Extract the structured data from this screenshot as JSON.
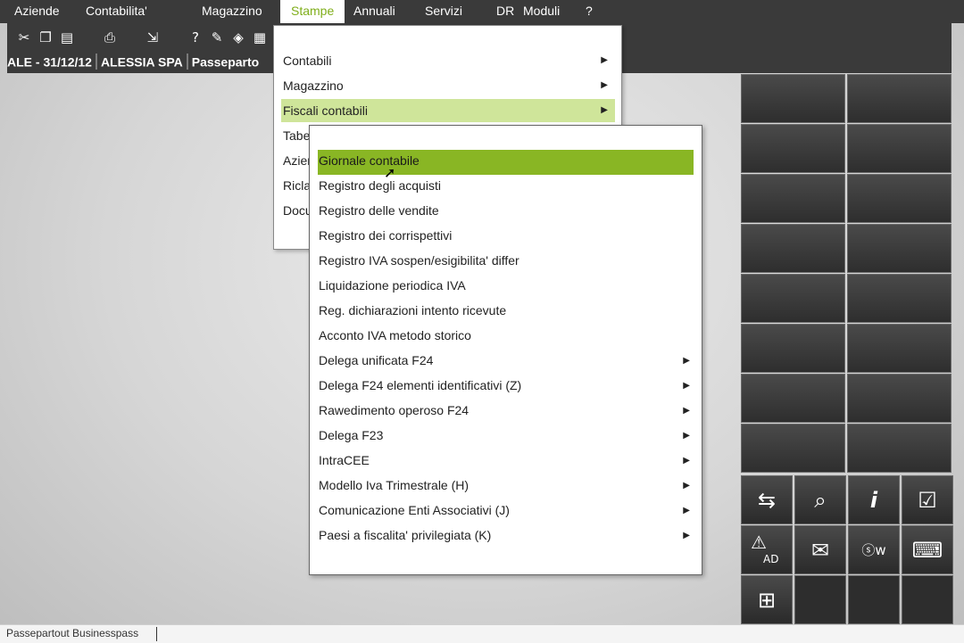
{
  "menubar": {
    "items": [
      "Aziende",
      "Contabilita'",
      "Magazzino",
      "Stampe",
      "Annuali",
      "Servizi",
      "DR",
      "Moduli",
      "?"
    ],
    "active": "Stampe"
  },
  "toolbar": {
    "icons": [
      "scissors-icon",
      "copy-icon",
      "paste-icon",
      "print-icon",
      "export-icon",
      "help-icon",
      "notes-icon",
      "box-icon",
      "calculator-icon"
    ]
  },
  "infobar": {
    "company_code_date": "ALE - 31/12/12",
    "company_name": "ALESSIA SPA",
    "app_name": "Passeparto"
  },
  "stampe_menu": {
    "items": [
      {
        "label": "Contabili",
        "has_submenu": true
      },
      {
        "label": "Magazzino",
        "has_submenu": true
      },
      {
        "label": "Fiscali contabili",
        "has_submenu": true,
        "highlighted": true
      },
      {
        "label": "Tabe",
        "has_submenu": false
      },
      {
        "label": "Azien",
        "has_submenu": false
      },
      {
        "label": "Ricla",
        "has_submenu": false
      },
      {
        "label": "Docu",
        "has_submenu": false
      }
    ]
  },
  "fiscali_submenu": {
    "items": [
      {
        "label": "Giornale contabile",
        "selected": true
      },
      {
        "label": "Registro degli acquisti"
      },
      {
        "label": "Registro delle vendite"
      },
      {
        "label": "Registro dei corrispettivi"
      },
      {
        "label": "Registro IVA sospen/esigibilita' differ"
      },
      {
        "label": "Liquidazione periodica IVA"
      },
      {
        "label": "Reg. dichiarazioni intento ricevute"
      },
      {
        "label": "Acconto IVA metodo storico"
      },
      {
        "label": "Delega unificata F24",
        "has_submenu": true
      },
      {
        "label": "Delega F24 elementi identificativi (Z)",
        "has_submenu": true
      },
      {
        "label": "Rawedimento operoso F24",
        "has_submenu": true
      },
      {
        "label": "Delega F23",
        "has_submenu": true
      },
      {
        "label": "IntraCEE",
        "has_submenu": true
      },
      {
        "label": "Modello Iva Trimestrale (H)",
        "has_submenu": true
      },
      {
        "label": "Comunicazione Enti Associativi (J)",
        "has_submenu": true
      },
      {
        "label": "Paesi a fiscalita' privilegiata (K)",
        "has_submenu": true
      }
    ]
  },
  "quick_icons": {
    "row1": [
      "transfer-icon",
      "document-search-icon",
      "info-icon",
      "checklist-icon"
    ],
    "row2_ad_label": "AD",
    "row2": [
      "warning-ad-icon",
      "mail-icon",
      "sw-icon",
      "keyboard-icon"
    ],
    "row3": [
      "grid-icon"
    ]
  },
  "statusbar": {
    "text": "Passepartout Businesspass"
  }
}
